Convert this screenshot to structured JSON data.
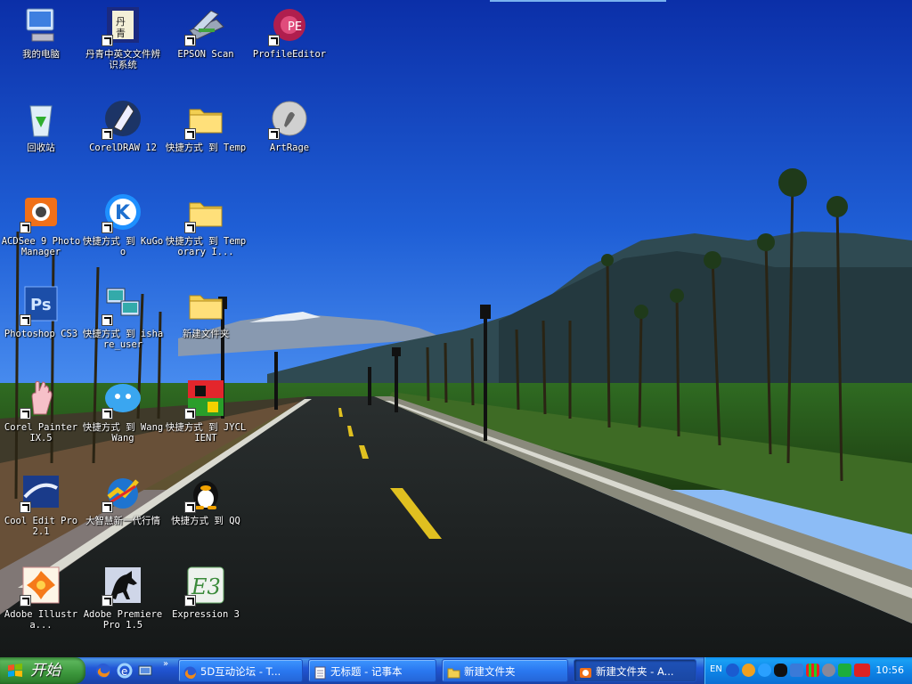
{
  "desktop": {
    "icons": [
      {
        "label": "我的电脑",
        "icon": "my-computer-icon",
        "shortcut": false
      },
      {
        "label": "丹青中英文文件辨识系统",
        "icon": "ocr-app-icon",
        "shortcut": true
      },
      {
        "label": "EPSON Scan",
        "icon": "scanner-icon",
        "shortcut": true
      },
      {
        "label": "ProfileEditor",
        "icon": "profile-editor-icon",
        "shortcut": true
      },
      {
        "label": "回收站",
        "icon": "recycle-bin-icon",
        "shortcut": false
      },
      {
        "label": "CorelDRAW 12",
        "icon": "coreldraw-icon",
        "shortcut": true
      },
      {
        "label": "快捷方式 到 Temp",
        "icon": "folder-icon",
        "shortcut": true
      },
      {
        "label": "ArtRage",
        "icon": "artrage-icon",
        "shortcut": true
      },
      {
        "label": "ACDSee 9 Photo Manager",
        "icon": "acdsee-icon",
        "shortcut": true
      },
      {
        "label": "快捷方式 到 KuGoo",
        "icon": "kugoo-icon",
        "shortcut": true
      },
      {
        "label": "快捷方式 到 Temporary I...",
        "icon": "folder-icon",
        "shortcut": true
      },
      {
        "label": "Photoshop CS3",
        "icon": "photoshop-icon",
        "shortcut": true
      },
      {
        "label": "快捷方式 到 ishare_user",
        "icon": "network-computers-icon",
        "shortcut": true
      },
      {
        "label": "新建文件夹",
        "icon": "folder-icon",
        "shortcut": false
      },
      {
        "label": "Corel Painter IX.5",
        "icon": "painter-hand-icon",
        "shortcut": true
      },
      {
        "label": "快捷方式 到 WangWang",
        "icon": "wangwang-icon",
        "shortcut": true
      },
      {
        "label": "快捷方式 到 JYCLIENT",
        "icon": "jyclient-icon",
        "shortcut": true
      },
      {
        "label": "Cool Edit Pro 2.1",
        "icon": "cool-edit-icon",
        "shortcut": true
      },
      {
        "label": "大智慧新一代行情",
        "icon": "stock-app-icon",
        "shortcut": true
      },
      {
        "label": "快捷方式 到 QQ",
        "icon": "qq-penguin-icon",
        "shortcut": true
      },
      {
        "label": "Adobe Illustra...",
        "icon": "illustrator-icon",
        "shortcut": true
      },
      {
        "label": "Adobe Premiere Pro 1.5",
        "icon": "premiere-horse-icon",
        "shortcut": true
      },
      {
        "label": "Expression 3",
        "icon": "expression-icon",
        "shortcut": true
      }
    ]
  },
  "taskbar": {
    "start_label": "开始",
    "quick_launch_more": "»",
    "tasks": [
      {
        "label": "5D互动论坛 - T...",
        "icon": "firefox-icon",
        "active": false
      },
      {
        "label": "无标题 - 记事本",
        "icon": "notepad-icon",
        "active": false
      },
      {
        "label": "新建文件夹",
        "icon": "folder-icon",
        "active": false
      },
      {
        "label": "新建文件夹 - A...",
        "icon": "acdsee-icon",
        "active": true
      }
    ],
    "tray": {
      "language": "EN",
      "clock": "10:56"
    }
  },
  "colors": {
    "taskbar_blue": "#2157d7",
    "start_green": "#3b963b",
    "tray_blue": "#0e86e8"
  }
}
